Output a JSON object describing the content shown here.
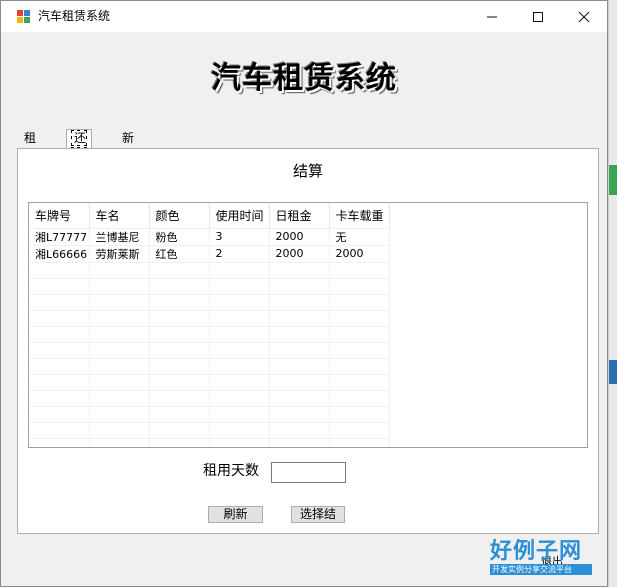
{
  "window": {
    "title": "汽车租赁系统",
    "controls": {
      "minimize": "—",
      "maximize": "☐",
      "close": "✕"
    }
  },
  "header": {
    "big_title": "汽车租赁系统"
  },
  "tabs": [
    {
      "label": "租车",
      "selected": false
    },
    {
      "label": "还车",
      "selected": true
    },
    {
      "label": "新车入库",
      "selected": false
    }
  ],
  "panel": {
    "section_title": "结算",
    "grid": {
      "columns": [
        "车牌号",
        "车名",
        "颜色",
        "使用时间",
        "日租金",
        "卡车载重"
      ],
      "rows": [
        [
          "湘L77777",
          "兰博基尼",
          "粉色",
          "3",
          "2000",
          "无"
        ],
        [
          "湘L66666",
          "劳斯莱斯",
          "红色",
          "2",
          "2000",
          "2000"
        ]
      ]
    },
    "days_label": "租用天数",
    "days_value": "",
    "refresh_button": "刷新",
    "settle_button": "选择结",
    "exit_button": "退出"
  },
  "watermark": {
    "main": "好例子网",
    "sub": "开发实例分享交流平台"
  },
  "colors": {
    "window_bg": "#f0f0f0",
    "panel_bg": "#ffffff",
    "accent": "#2d8fd6"
  }
}
